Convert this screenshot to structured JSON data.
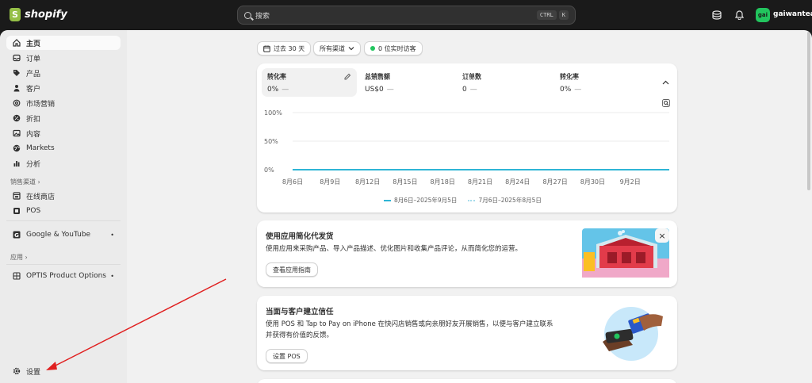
{
  "brand": {
    "name": "shopify"
  },
  "search": {
    "placeholder": "搜索",
    "shortcut_1": "CTRL",
    "shortcut_2": "K"
  },
  "store": {
    "avatar": "gai",
    "name": "gaiwantea"
  },
  "sidebar": {
    "items": [
      {
        "label": "主页",
        "icon": "home-icon"
      },
      {
        "label": "订单",
        "icon": "inbox-icon"
      },
      {
        "label": "产品",
        "icon": "tag-icon"
      },
      {
        "label": "客户",
        "icon": "person-icon"
      },
      {
        "label": "市场营销",
        "icon": "target-icon"
      },
      {
        "label": "折扣",
        "icon": "discount-icon"
      },
      {
        "label": "内容",
        "icon": "image-icon"
      },
      {
        "label": "Markets",
        "icon": "globe-icon"
      },
      {
        "label": "分析",
        "icon": "bar-chart-icon"
      }
    ],
    "sales_channels_label": "销售渠道",
    "channels": [
      {
        "label": "在线商店"
      },
      {
        "label": "POS"
      }
    ],
    "google_label": "Google & YouTube",
    "apps_label": "应用",
    "app_items": [
      {
        "label": "OPTIS Product Options"
      }
    ],
    "settings_label": "设置"
  },
  "filters": {
    "date_range": "过去 30 天",
    "channels": "所有渠道",
    "live_visitors": "0 位实时访客"
  },
  "metrics": [
    {
      "title": "转化率",
      "value": "0%"
    },
    {
      "title": "总销售额",
      "value": "US$0"
    },
    {
      "title": "订单数",
      "value": "0"
    },
    {
      "title": "转化率",
      "value": "0%"
    }
  ],
  "chart_data": {
    "type": "line",
    "y_ticks": [
      "100%",
      "50%",
      "0%"
    ],
    "ylim": [
      0,
      100
    ],
    "categories": [
      "8月6日",
      "8月9日",
      "8月12日",
      "8月15日",
      "8月18日",
      "8月21日",
      "8月24日",
      "8月27日",
      "8月30日",
      "9月2日"
    ],
    "series": [
      {
        "name": "8月6日–2025年9月5日",
        "values": [
          0,
          0,
          0,
          0,
          0,
          0,
          0,
          0,
          0,
          0
        ],
        "color": "#2fb5d6"
      },
      {
        "name": "7月6日–2025年8月5日",
        "values": [
          0,
          0,
          0,
          0,
          0,
          0,
          0,
          0,
          0,
          0
        ],
        "color": "#a6dcec"
      }
    ],
    "grid": true
  },
  "card_apps": {
    "title": "使用应用简化代发货",
    "text": "使用应用来采购产品、导入产品描述、优化图片和收集产品评论，从而简化您的运营。",
    "button": "查看应用指南"
  },
  "card_pos": {
    "title": "当面与客户建立信任",
    "text_line1": "使用 POS 和 Tap to Pay on iPhone 在快闪店销售或向亲朋好友开展销售，以便与客户建立联系",
    "text_line2": "并获得有价值的反馈。",
    "button": "设置 POS"
  }
}
